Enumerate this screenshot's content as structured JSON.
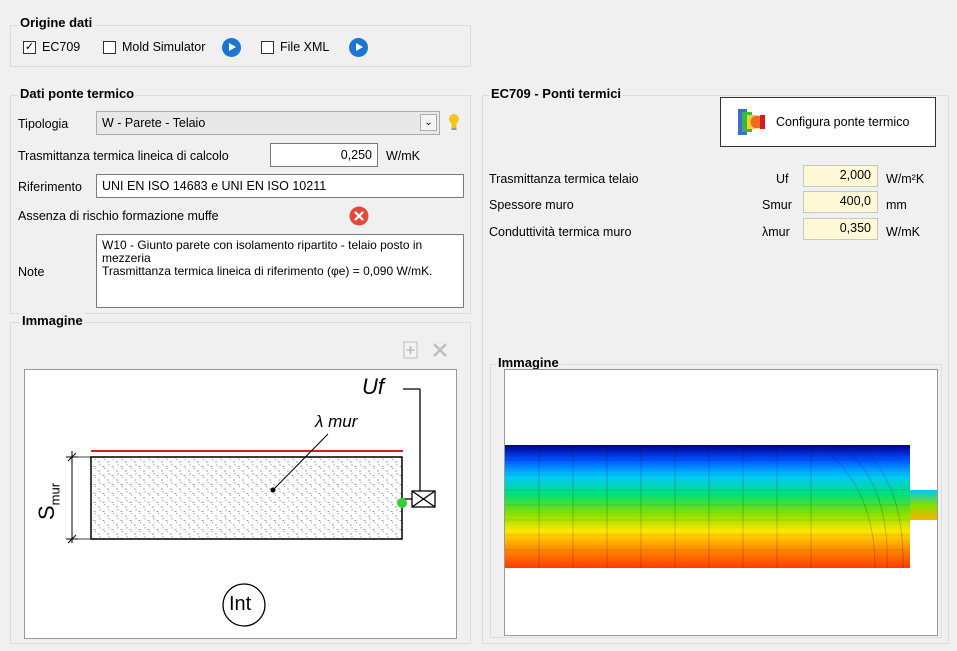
{
  "origine": {
    "title": "Origine dati",
    "ec709_label": "EC709",
    "ec709_checked": true,
    "mold_label": "Mold Simulator",
    "mold_checked": false,
    "xml_label": "File XML",
    "xml_checked": false
  },
  "dati": {
    "title": "Dati ponte termico",
    "tipologia_label": "Tipologia",
    "tipologia_value": "W - Parete - Telaio",
    "trasmittanza_label": "Trasmittanza termica lineica di calcolo",
    "trasmittanza_value": "0,250",
    "trasmittanza_unit": "W/mK",
    "riferimento_label": "Riferimento",
    "riferimento_value": "UNI EN ISO 14683 e UNI EN ISO 10211",
    "muffe_label": "Assenza di rischio formazione muffe",
    "note_label": "Note",
    "note_value": "W10 - Giunto parete con isolamento ripartito - telaio posto in mezzeria\nTrasmittanza termica lineica di riferimento (φe) = 0,090 W/mK."
  },
  "immagine_left": {
    "title": "Immagine",
    "label_uf": "Uf",
    "label_lambda": "λ mur",
    "label_s": "S",
    "label_s_sub": "mur",
    "label_int": "Int"
  },
  "ec709": {
    "title": "EC709 - Ponti termici",
    "configura_label": "Configura ponte termico",
    "rows": [
      {
        "label": "Trasmittanza termica telaio",
        "sym": "Uf",
        "value": "2,000",
        "unit": "W/m²K"
      },
      {
        "label": "Spessore muro",
        "sym": "Smur",
        "value": "400,0",
        "unit": "mm"
      },
      {
        "label": "Conduttività termica muro",
        "sym": "λmur",
        "value": "0,350",
        "unit": "W/mK"
      }
    ]
  },
  "immagine_right": {
    "title": "Immagine"
  },
  "colors": {
    "accent": "#1b76d1",
    "error": "#e04a3a",
    "red_line": "#e0191c",
    "green_dot": "#2fd12f",
    "yellow_field": "#fff8d6"
  }
}
